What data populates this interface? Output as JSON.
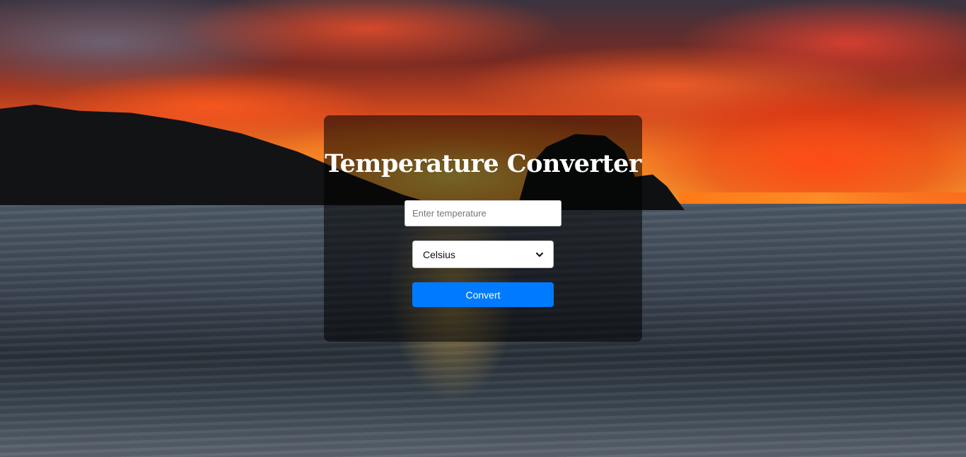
{
  "app": {
    "title": "Temperature Converter"
  },
  "form": {
    "input_placeholder": "Enter temperature",
    "input_value": "",
    "unit_selected": "Celsius",
    "convert_label": "Convert"
  },
  "background": {
    "description_icon": "sunset-sea-background"
  },
  "colors": {
    "button": "#007bff",
    "card_overlay": "rgba(0,0,0,0.55)",
    "title": "#ffffff"
  }
}
